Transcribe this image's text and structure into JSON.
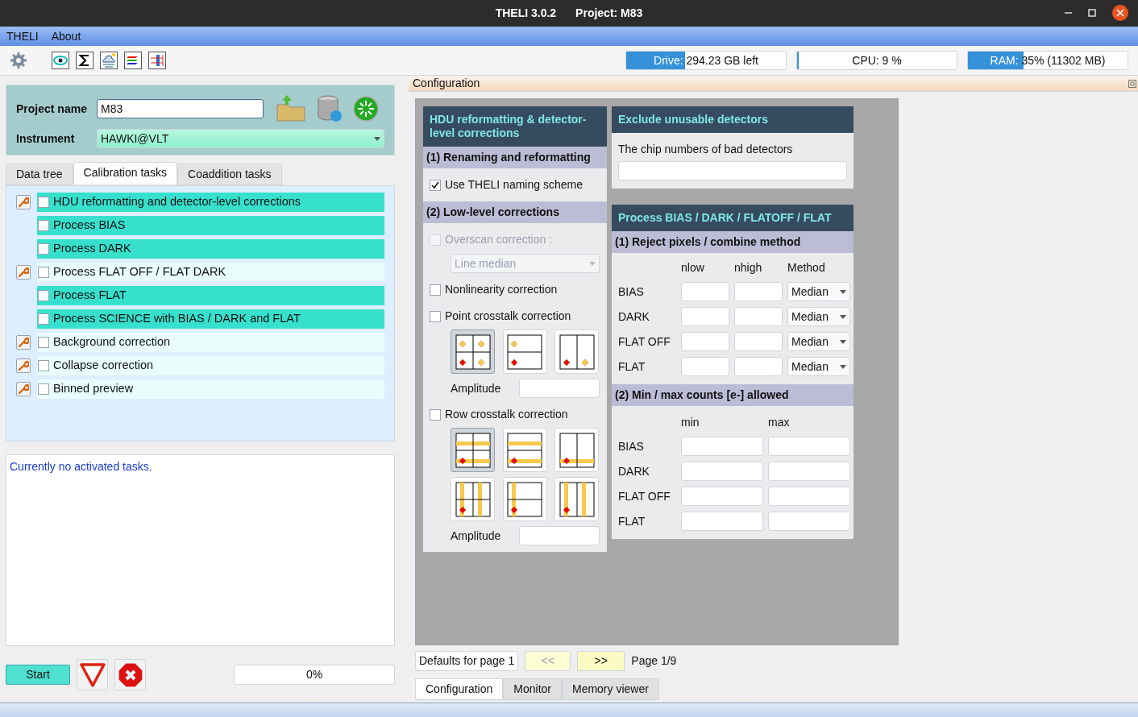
{
  "window": {
    "title": "THELI 3.0.2",
    "project": "Project: M83"
  },
  "menu": [
    "THELI",
    "About"
  ],
  "monitors": [
    {
      "label": "Drive:",
      "reading": "294.23 GB left",
      "level": 0.37
    },
    {
      "label": "CPU:",
      "reading": "9 %",
      "level": 0.01
    },
    {
      "label": "RAM:",
      "reading": "35% (11302 MB)",
      "level": 0.35
    }
  ],
  "project": {
    "name_label": "Project name",
    "name_value": "M83",
    "instrument_label": "Instrument",
    "instrument_value": "HAWKI@VLT"
  },
  "left_tabs": [
    {
      "label": "Data tree",
      "selected": false
    },
    {
      "label": "Calibration tasks",
      "selected": true
    },
    {
      "label": "Coaddition tasks",
      "selected": false
    }
  ],
  "tasks": [
    {
      "label": "HDU reformatting and detector-level corrections",
      "checked": false,
      "highlighted": true,
      "wrench": true
    },
    {
      "label": "Process BIAS",
      "checked": false,
      "highlighted": true,
      "wrench": false
    },
    {
      "label": "Process DARK",
      "checked": false,
      "highlighted": true,
      "wrench": false
    },
    {
      "label": "Process FLAT OFF / FLAT DARK",
      "checked": false,
      "highlighted": false,
      "wrench": true
    },
    {
      "label": "Process FLAT",
      "checked": false,
      "highlighted": true,
      "wrench": false
    },
    {
      "label": "Process SCIENCE with BIAS / DARK and FLAT",
      "checked": false,
      "highlighted": true,
      "wrench": false
    },
    {
      "label": "Background correction",
      "checked": false,
      "highlighted": false,
      "wrench": true
    },
    {
      "label": "Collapse correction",
      "checked": false,
      "highlighted": false,
      "wrench": true
    },
    {
      "label": "Binned preview",
      "checked": false,
      "highlighted": false,
      "wrench": true
    }
  ],
  "log": "Currently no activated tasks.",
  "start_button": "Start",
  "progress": {
    "reading": "0%",
    "level": 0
  },
  "config_title": "Configuration",
  "hdu_panel": {
    "title": "HDU reformatting & detector-level corrections",
    "section1": "(1) Renaming and reformatting",
    "naming": {
      "label": "Use THELI naming scheme",
      "checked": true
    },
    "section2": "(2) Low-level corrections",
    "overscan": {
      "label": "Overscan correction :",
      "checked": false,
      "disabled": true,
      "method": "Line median"
    },
    "nonlinearity": {
      "label": "Nonlinearity correction",
      "checked": false
    },
    "point_crosstalk": {
      "label": "Point crosstalk correction",
      "checked": false,
      "modes": [
        {
          "selected": true
        },
        {
          "selected": false
        },
        {
          "selected": false
        }
      ],
      "amplitude_label": "Amplitude"
    },
    "row_crosstalk": {
      "label": "Row crosstalk correction",
      "checked": false,
      "modes": [
        {
          "selected": true
        },
        {
          "selected": false
        },
        {
          "selected": false
        },
        {
          "selected": false
        },
        {
          "selected": false
        },
        {
          "selected": false
        }
      ],
      "amplitude_label": "Amplitude"
    }
  },
  "exclude_panel": {
    "title": "Exclude unusable detectors",
    "label": "The chip numbers of bad detectors"
  },
  "process_panel": {
    "title": "Process BIAS / DARK / FLATOFF / FLAT",
    "section1": "(1) Reject pixels / combine method",
    "columns1": [
      "nlow",
      "nhigh",
      "Method"
    ],
    "rows1": [
      {
        "label": "BIAS",
        "method": "Median"
      },
      {
        "label": "DARK",
        "method": "Median"
      },
      {
        "label": "FLAT OFF",
        "method": "Median"
      },
      {
        "label": "FLAT",
        "method": "Median"
      }
    ],
    "section2": "(2) Min / max counts [e-] allowed",
    "columns2": [
      "min",
      "max"
    ],
    "rows2": [
      "BIAS",
      "DARK",
      "FLAT OFF",
      "FLAT"
    ]
  },
  "pager": {
    "defaults": "Defaults for page 1",
    "prev": "<<",
    "next": ">>",
    "page": "Page 1/9"
  },
  "bottom_tabs": [
    {
      "label": "Configuration",
      "selected": true
    },
    {
      "label": "Monitor",
      "selected": false
    },
    {
      "label": "Memory viewer",
      "selected": false
    }
  ]
}
